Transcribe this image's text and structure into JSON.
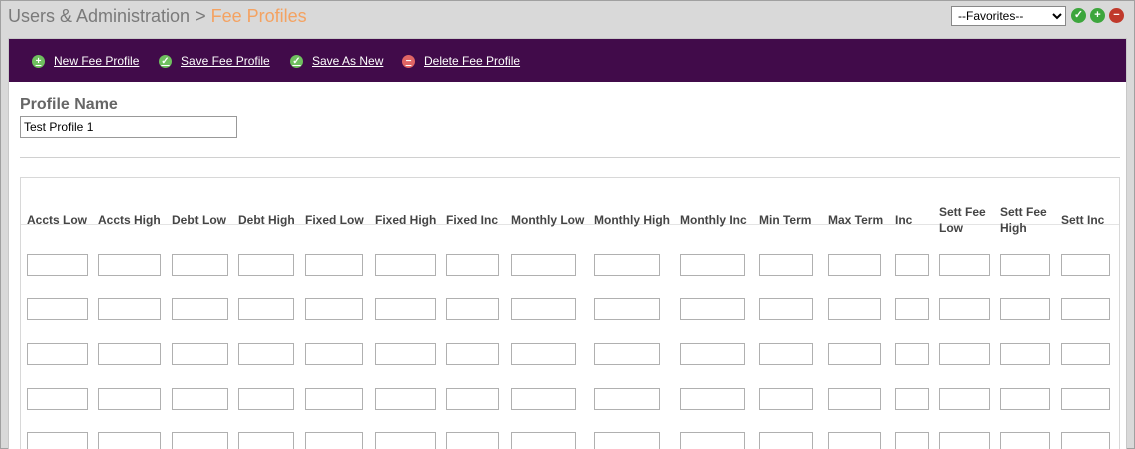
{
  "breadcrumb": {
    "parent": "Users & Administration",
    "separator": " > ",
    "current": "Fee Profiles"
  },
  "favorites": {
    "selected": "--Favorites--"
  },
  "title_icons": [
    "check-icon",
    "plus-icon",
    "minus-icon"
  ],
  "toolbar": {
    "new_label": "New Fee Profile",
    "save_label": "Save Fee Profile",
    "save_as_label": "Save As New",
    "delete_label": "Delete Fee Profile"
  },
  "profile": {
    "label": "Profile Name",
    "value": "Test Profile 1"
  },
  "table": {
    "columns": [
      "Accts Low",
      "Accts High",
      "Debt Low",
      "Debt High",
      "Fixed Low",
      "Fixed High",
      "Fixed Inc",
      "Monthly Low",
      "Monthly High",
      "Monthly Inc",
      "Min Term",
      "Max Term",
      "Inc",
      "Sett Fee Low",
      "Sett Fee High",
      "Sett Inc"
    ],
    "rows": [
      [
        "",
        "",
        "",
        "",
        "",
        "",
        "",
        "",
        "",
        "",
        "",
        "",
        "",
        "",
        "",
        ""
      ],
      [
        "",
        "",
        "",
        "",
        "",
        "",
        "",
        "",
        "",
        "",
        "",
        "",
        "",
        "",
        "",
        ""
      ],
      [
        "",
        "",
        "",
        "",
        "",
        "",
        "",
        "",
        "",
        "",
        "",
        "",
        "",
        "",
        "",
        ""
      ],
      [
        "",
        "",
        "",
        "",
        "",
        "",
        "",
        "",
        "",
        "",
        "",
        "",
        "",
        "",
        "",
        ""
      ],
      [
        "",
        "",
        "",
        "",
        "",
        "",
        "",
        "",
        "",
        "",
        "",
        "",
        "",
        "",
        "",
        ""
      ]
    ]
  },
  "colors": {
    "toolbar_bg": "#410b4a",
    "breadcrumb_current": "#f4a261",
    "page_bg": "#d9d9d9"
  }
}
